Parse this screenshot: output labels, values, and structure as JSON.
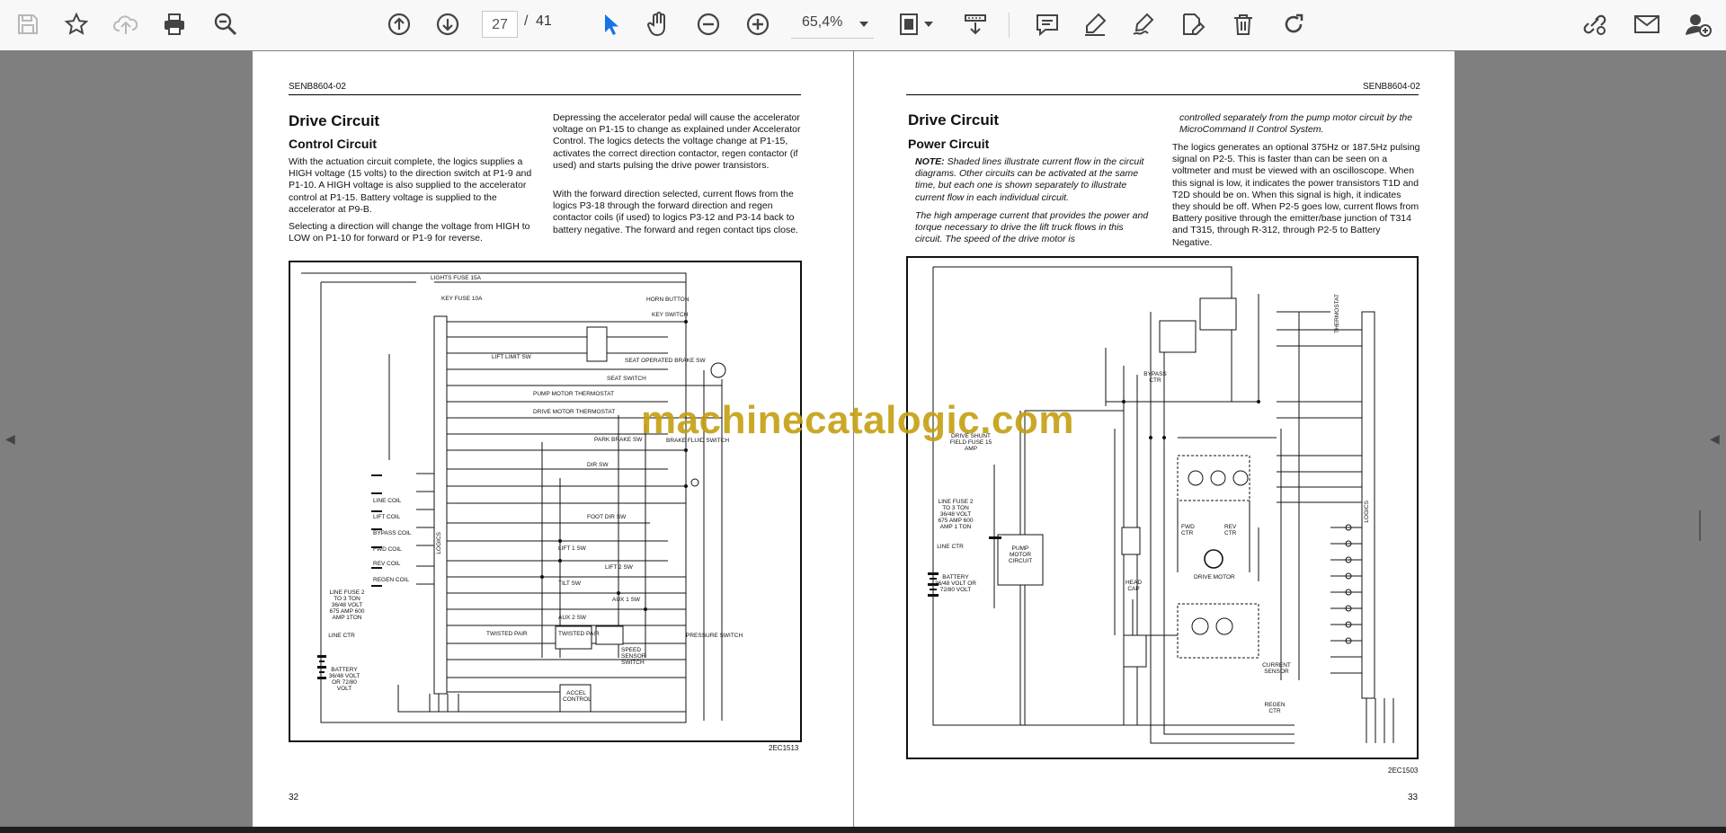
{
  "toolbar": {
    "page_current": "27",
    "page_separator": "/",
    "page_total": "41",
    "zoom": "65,4%"
  },
  "left_page": {
    "header": "SENB8604-02",
    "title": "Drive Circuit",
    "subtitle": "Control Circuit",
    "col1_p1": "With the actuation circuit complete, the logics supplies a HIGH voltage (15 volts) to the direction switch at P1-9 and P1-10. A HIGH voltage is also supplied to the accelerator control at P1-15. Battery voltage is supplied to the accelerator at P9-B.",
    "col1_p2": "Selecting a direction will change the voltage from HIGH to LOW on P1-10 for forward or P1-9 for reverse.",
    "col2_p1": "Depressing the accelerator pedal will cause the accelerator voltage on P1-15 to change as explained under Accelerator Control. The logics detects the voltage change at P1-15, activates the correct direction contactor, regen contactor (if used) and starts pulsing the drive power transistors.",
    "col2_p2": "With the forward direction selected, current flows from the logics P3-18 through the forward direction and regen contactor coils (if used) to logics P3-12 and P3-14 back to battery negative. The forward and regen contact tips close.",
    "figure_id": "2EC1513",
    "page_number": "32",
    "diagram_labels": {
      "lights_fuse": "LIGHTS FUSE 15A",
      "key_fuse": "KEY FUSE 10A",
      "horn_button": "HORN BUTTON",
      "key_switch": "KEY SWITCH",
      "lift_limit": "LIFT LIMIT SW",
      "seat_brake": "SEAT OPERATED BRAKE SW",
      "seat_switch": "SEAT SWITCH",
      "pump_thermo": "PUMP MOTOR THERMOSTAT",
      "drive_thermo": "DRIVE MOTOR THERMOSTAT",
      "park_brake": "PARK BRAKE SW",
      "brake_fluid": "BRAKE FLUID SWITCH",
      "dir_sw": "DIR SW",
      "foot_dir": "FOOT DIR SW",
      "lift1": "LIFT 1 SW",
      "lift2": "LIFT 2 SW",
      "tilt": "TILT SW",
      "aux1": "AUX 1 SW",
      "aux2": "AUX 2 SW",
      "pressure": "PRESSURE SWITCH",
      "twisted1": "TWISTED PAIR",
      "twisted2": "TWISTED PAIR",
      "speed_sensor": "SPEED SENSOR SWITCH",
      "accel": "ACCEL CONTROL",
      "line_fuse": "LINE FUSE 2 TO 3 TON 36/48 VOLT 675 AMP 600 AMP 1TON",
      "line_ctr": "LINE CTR",
      "battery": "BATTERY 36/48 VOLT OR 72/80 VOLT",
      "logics": "LOGICS",
      "line_coil": "LINE COIL",
      "lift_coil": "LIFT COIL",
      "bypass_coil": "BYPASS COIL",
      "fwd_coil": "FWD COIL",
      "rev_coil": "REV COIL",
      "regen_coil": "REGEN COIL"
    }
  },
  "right_page": {
    "header": "SENB8604-02",
    "title": "Drive Circuit",
    "subtitle": "Power Circuit",
    "note_label": "NOTE:",
    "note_text": "Shaded lines illustrate current flow in the circuit diagrams. Other circuits can be activated at the same time, but each one is shown separately to illustrate current flow in each individual circuit.",
    "col1_p2": "The high amperage current that provides the power and torque necessary to drive the lift truck flows in this circuit. The speed of the drive motor is",
    "col2_p1": "controlled separately from the pump motor circuit by the MicroCommand II Control System.",
    "col2_p2": "The logics generates an optional 375Hz or 187.5Hz pulsing signal on P2-5. This is faster than can be seen on a voltmeter and must be viewed with an oscilloscope. When this signal is low, it indicates the power transistors T1D and T2D should be on. When this signal is high, it indicates they should be off. When P2-5 goes low, current flows from Battery positive through the emitter/base junction of T314 and T315, through R-312, through P2-5 to Battery Negative.",
    "figure_id": "2EC1503",
    "page_number": "33",
    "diagram_labels": {
      "drive_shunt": "DRIVE SHUNT FIELD FUSE 15 AMP",
      "line_fuse": "LINE FUSE 2 TO 3 TON 36/48 VOLT 675 AMP 600 AMP 1 TON",
      "line_ctr": "LINE CTR",
      "battery": "BATTERY 36/48 VOLT OR 72/80 VOLT",
      "pump_motor": "PUMP MOTOR CIRCUIT",
      "head_cap": "HEAD CAP",
      "bypass_ctr": "BYPASS CTR",
      "fwd_ctr": "FWD CTR",
      "rev_ctr": "REV CTR",
      "drive_motor": "DRIVE MOTOR",
      "current_sensor": "CURRENT SENSOR",
      "regen_ctr": "REGEN CTR",
      "logics": "LOGICS",
      "thermostat": "THERMOSTAT"
    }
  },
  "watermark": "machinecatalogic.com"
}
